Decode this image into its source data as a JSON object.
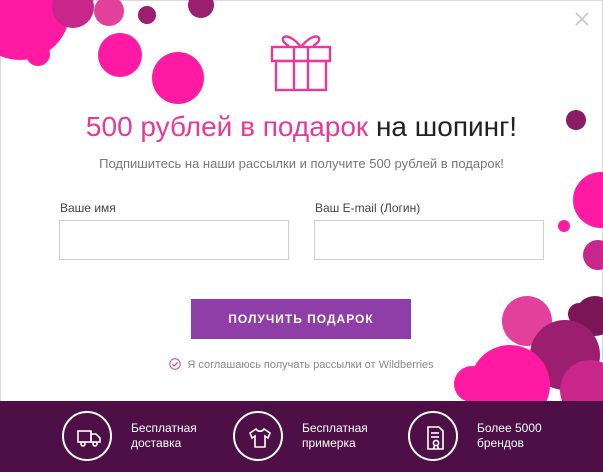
{
  "headline": {
    "accent": "500 рублей в подарок",
    "rest": "на шопинг!"
  },
  "subtitle": "Подпишитесь на наши рассылки и получите 500 рублей в подарок!",
  "form": {
    "name_label": "Ваше имя",
    "email_label": "Ваш E-mail (Логин)",
    "submit_label": "ПОЛУЧИТЬ ПОДАРОК",
    "consent_text": "Я соглашаюсь получать рассылки от Wildberries"
  },
  "features": [
    {
      "icon": "delivery-truck-icon",
      "line1": "Бесплатная",
      "line2": "доставка"
    },
    {
      "icon": "tshirt-icon",
      "line1": "Бесплатная",
      "line2": "примерка"
    },
    {
      "icon": "certificate-icon",
      "line1": "Более 5000",
      "line2": "брендов"
    }
  ],
  "colors": {
    "accent_pink": "#e63a9a",
    "button_purple": "#8e3ea6",
    "footer_bg": "#4d0f46",
    "bubble_magenta": "#ff1aa3",
    "bubble_plum": "#9b1f6e",
    "bubble_dark": "#7a1656"
  }
}
